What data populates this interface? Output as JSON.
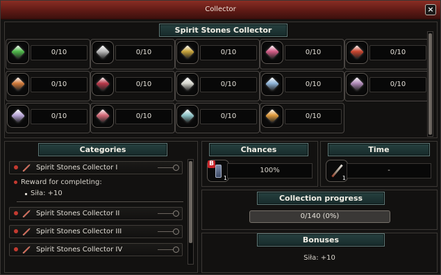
{
  "window": {
    "title": "Collector",
    "close_glyph": "×"
  },
  "collector": {
    "header": "Spirit Stones Collector",
    "items": [
      {
        "count": "0/10",
        "icon": "green-stone-icon",
        "color": "#4fb84a"
      },
      {
        "count": "0/10",
        "icon": "silver-stone-icon",
        "color": "#b9b9b9"
      },
      {
        "count": "0/10",
        "icon": "gold-stone-icon",
        "color": "#c8a43a"
      },
      {
        "count": "0/10",
        "icon": "pink-stone-icon",
        "color": "#d25c86"
      },
      {
        "count": "0/10",
        "icon": "red-stone-icon",
        "color": "#c9452f"
      },
      {
        "count": "0/10",
        "icon": "orange-stone-icon",
        "color": "#d27a3a"
      },
      {
        "count": "0/10",
        "icon": "crimson-stone-icon",
        "color": "#b8384a"
      },
      {
        "count": "0/10",
        "icon": "white-stone-icon",
        "color": "#d8d8d0"
      },
      {
        "count": "0/10",
        "icon": "blue-stone-icon",
        "color": "#8fb4d8"
      },
      {
        "count": "0/10",
        "icon": "violet-stone-icon",
        "color": "#b08ab8"
      },
      {
        "count": "0/10",
        "icon": "lavender-stone-icon",
        "color": "#b9a6d8"
      },
      {
        "count": "0/10",
        "icon": "rose-stone-icon",
        "color": "#d46a78"
      },
      {
        "count": "0/10",
        "icon": "teal-stone-icon",
        "color": "#8fc4c8"
      },
      {
        "count": "0/10",
        "icon": "amber-stone-icon",
        "color": "#e09a3c"
      }
    ]
  },
  "categories": {
    "header": "Categories",
    "items": [
      {
        "label": "Spirit Stones Collector I"
      },
      {
        "label": "Spirit Stones Collector II"
      },
      {
        "label": "Spirit Stones Collector III"
      },
      {
        "label": "Spirit Stones Collector IV"
      }
    ],
    "reward_title": "Reward for completing:",
    "reward_line": "Siła: +10"
  },
  "chances": {
    "header": "Chances",
    "value": "100%",
    "badge": "B",
    "qty": "1"
  },
  "time": {
    "header": "Time",
    "value": "-",
    "qty": "1"
  },
  "progress": {
    "header": "Collection progress",
    "text": "0/140 (0%)",
    "fraction": 0
  },
  "bonuses": {
    "header": "Bonuses",
    "text": "Siła: +10"
  },
  "colors": {
    "title_bar": "#6b1f18",
    "header_bg": "#1f3535",
    "accent_red": "#c43a30"
  }
}
